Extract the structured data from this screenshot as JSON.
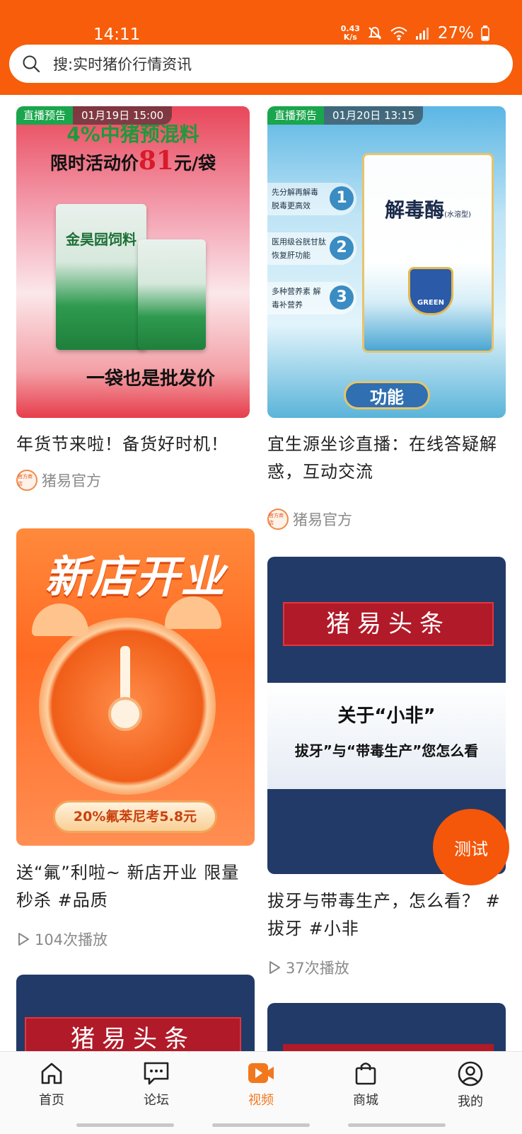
{
  "status_bar": {
    "time": "14:11",
    "netspeed_value": "0.43",
    "netspeed_unit": "K/s",
    "battery": "27%"
  },
  "search": {
    "placeholder": "搜:实时猪价行情资讯"
  },
  "colors": {
    "brand_orange": "#f75d0a",
    "active_tab": "#f2781e",
    "live_badge": "#1aa64c"
  },
  "feed": {
    "left": [
      {
        "badge": {
          "label": "直播预告",
          "time": "01月19日 15:00"
        },
        "poster": {
          "line1": "4%中猪预混料",
          "line2_a": "限时活动价",
          "line2_price": "81",
          "line2_b": "元/袋",
          "bottom": "一袋也是批发价",
          "bag_label": "金昊园饲料"
        },
        "title": "年货节来啦！备货好时机！",
        "author": "猪易官方",
        "avatar_text": "官方商店"
      },
      {
        "poster": {
          "top": "新店开业",
          "pill": "20%氟苯尼考5.8元"
        },
        "title": "送“氟”利啦~ 新店开业 限量秒杀 #品质",
        "plays": "104次播放"
      },
      {
        "poster": {
          "banner": "猪易头条"
        }
      }
    ],
    "right": [
      {
        "badge": {
          "label": "直播预告",
          "time": "01月20日 13:15"
        },
        "poster": {
          "features": [
            "先分解再解毒 脱毒更高效",
            "医用级谷胱甘肽 恢复肝功能",
            "多种营养素 解毒补营养"
          ],
          "feature_nums": [
            "1",
            "2",
            "3"
          ],
          "product": "解毒酶",
          "product_tag": "(水溶型)",
          "shield": "GREEN",
          "button": "功能"
        },
        "title": "宜生源坐诊直播：在线答疑解惑，互动交流",
        "author": "猪易官方",
        "avatar_text": "官方商店"
      },
      {
        "poster": {
          "banner": "猪易头条",
          "line1": "关于“小非”",
          "line2": "拔牙”与“带毒生产”您怎么看"
        },
        "title": "拔牙与带毒生产，怎么看？ #拔牙 #小非",
        "plays": "37次播放"
      },
      {
        "poster": {}
      }
    ]
  },
  "fab": {
    "label": "测试"
  },
  "tabbar": {
    "items": [
      {
        "label": "首页",
        "icon": "home-icon"
      },
      {
        "label": "论坛",
        "icon": "forum-icon"
      },
      {
        "label": "视频",
        "icon": "video-icon",
        "active": true
      },
      {
        "label": "商城",
        "icon": "shopping-bag-icon"
      },
      {
        "label": "我的",
        "icon": "profile-icon"
      }
    ]
  }
}
